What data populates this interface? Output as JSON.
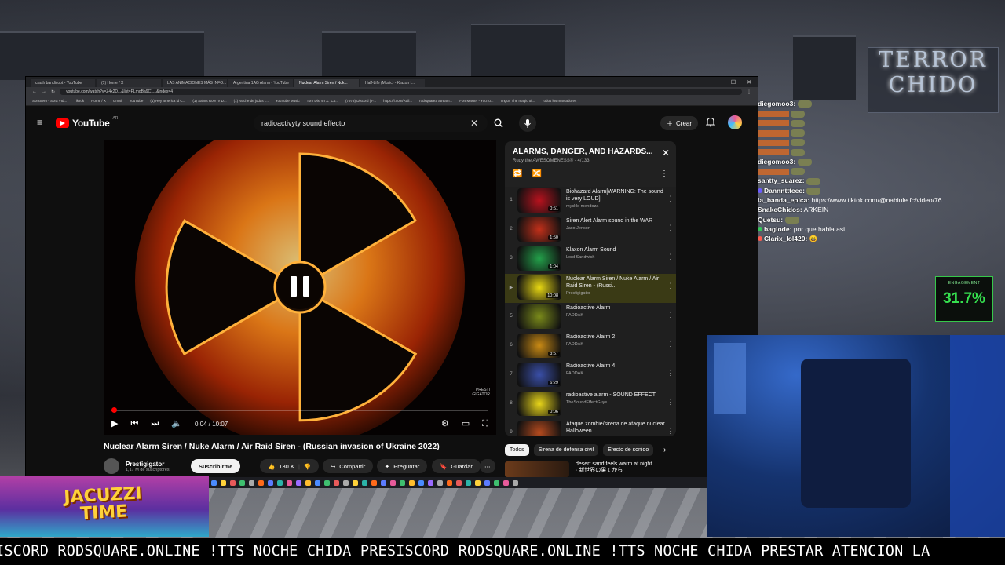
{
  "browser": {
    "tabs": [
      "crash bandicoot - YouTube",
      "(1) Home / X",
      "LAS ANIMACIONES MÁS INFO...",
      "Argentina 1AG Alarm - YouTube",
      "Nuclear Alarm Siren / Nuk...",
      "Half-Life (Music) - Klaxon I..."
    ],
    "active_tab_index": 4,
    "url": "youtube.com/watch?v=Z4x2D...&list=PLmqBa9C1...&index=4",
    "bookmarks": [
      "SoraSero - Sora VId...",
      "TikTok",
      "Home / X",
      "Gmail",
      "YouTube",
      "(1) Hey america id C...",
      "(1) Saints Row IV D...",
      "(1) Noche de jodas t...",
      "YouTube Music",
      "Tom Dixi sn X: 'Co...",
      "(7973) Discord | F...",
      "https://i.com/Rail...",
      "rodsquarez Stream...",
      "Fort Master - YouTu...",
      "Imgur: The magic of...",
      "Todos los marcadores"
    ]
  },
  "youtube": {
    "logo_text": "YouTube",
    "country_code": "AR",
    "search_query": "radioactivyty sound effecto",
    "create_label": "Crear"
  },
  "player": {
    "time_current": "0:04",
    "time_total": "10:07",
    "progress": 0.0066,
    "watermark": "PRESTI\nGIGATOR"
  },
  "video": {
    "title": "Nuclear Alarm Siren / Nuke Alarm / Air Raid Siren - (Russian invasion of Ukraine 2022)",
    "channel": "Prestigigator",
    "subscribers": "1,17 M de suscriptores",
    "subscribe_label": "Suscribirme",
    "likes": "130 K",
    "share_label": "Compartir",
    "ask_label": "Preguntar",
    "save_label": "Guardar"
  },
  "playlist": {
    "title": "ALARMS, DANGER, AND HAZARDS...",
    "subtitle": "Rudy the AWESOMENESS® - 4/133",
    "items": [
      {
        "idx": "1",
        "title": "Biohazard Alarm[WARNING: The sound is very LOUD]",
        "author": "myckle mendoza",
        "duration": "0:51",
        "color": "#b8121e"
      },
      {
        "idx": "2",
        "title": "Siren Alert Alarm sound in the WAR",
        "author": "Jaxo Jenson",
        "duration": "1:50",
        "color": "#c2301a"
      },
      {
        "idx": "3",
        "title": "Klaxon Alarm Sound",
        "author": "Lord Sandwich",
        "duration": "1:04",
        "color": "#23a04a"
      },
      {
        "idx": "▶",
        "title": "Nuclear Alarm Siren / Nuke Alarm / Air Raid Siren - (Russi...",
        "author": "Prestigigator",
        "duration": "10:08",
        "color": "#e8d812"
      },
      {
        "idx": "5",
        "title": "Radioactive Alarm",
        "author": "FADDAK",
        "duration": "",
        "color": "#7a8a1a"
      },
      {
        "idx": "6",
        "title": "Radioactive Alarm 2",
        "author": "FADDAK",
        "duration": "3:57",
        "color": "#c98a14"
      },
      {
        "idx": "7",
        "title": "Radioactive Alarm 4",
        "author": "FADDAK",
        "duration": "6:29",
        "color": "#3a4fa8"
      },
      {
        "idx": "8",
        "title": "radioactive alarm - SOUND EFFECT",
        "author": "TheSoundEffectGuys",
        "duration": "0:06",
        "color": "#e9d61a"
      },
      {
        "idx": "9",
        "title": "Ataque zombie/sirena de ataque nuclear Halloween",
        "author": "",
        "duration": "2:22",
        "color": "#b44a1e"
      }
    ]
  },
  "chips": [
    "Todos",
    "Sirena de defensa civil",
    "Efecto de sonido"
  ],
  "recommended": {
    "title": "desert sand feels warm at night",
    "subtitle": "· 新世界の果てから"
  },
  "overlay": {
    "brand_line1": "TERROR",
    "brand_line2": "CHIDO",
    "engagement_label": "ENGAGEMENT",
    "engagement_value": "31.7%",
    "jacuzzi_line1": "JACUZZI",
    "jacuzzi_line2": "TIME",
    "ticker": "ISCORD RODSQUARE.ONLINE !TTS NOCHE CHIDA PRESISCORD RODSQUARE.ONLINE !TTS NOCHE CHIDA PRESTAR ATENCION LA"
  },
  "chat": [
    {
      "user": "diegomoo3:",
      "text": "",
      "emote": true,
      "color": ""
    },
    {
      "user": "",
      "text": "",
      "emote": true,
      "color": ""
    },
    {
      "user": "",
      "text": "",
      "emote": true,
      "color": ""
    },
    {
      "user": "",
      "text": "",
      "emote": true,
      "color": ""
    },
    {
      "user": "",
      "text": "",
      "emote": true,
      "color": ""
    },
    {
      "user": "",
      "text": "",
      "emote": true,
      "color": ""
    },
    {
      "user": "diegomoo3:",
      "text": "",
      "emote": true,
      "color": ""
    },
    {
      "user": "",
      "text": "",
      "emote": true,
      "color": ""
    },
    {
      "user": "santty_suarez:",
      "text": "",
      "emote": true,
      "color": ""
    },
    {
      "user": "Dannnttteee:",
      "text": "",
      "emote": true,
      "color": "#6c5cff"
    },
    {
      "user": "la_banda_epica:",
      "text": "https://www.tiktok.com/@nabiule.fc/video/76",
      "emote": false,
      "color": ""
    },
    {
      "user": "SnakeChidos:",
      "text": "ARKEIN",
      "emote": false,
      "color": ""
    },
    {
      "user": "Quetsu:",
      "text": "",
      "emote": true,
      "color": ""
    },
    {
      "user": "bagiode:",
      "text": "por que habla asi",
      "emote": false,
      "color": "#34c759"
    },
    {
      "user": "Clarix_lol420:",
      "text": "😄",
      "emote": false,
      "color": "#ff5a4e"
    }
  ],
  "colors": {
    "yt_red": "#ff0000",
    "engagement_green": "#36e04f",
    "playlist_active": "#3a3a15"
  }
}
